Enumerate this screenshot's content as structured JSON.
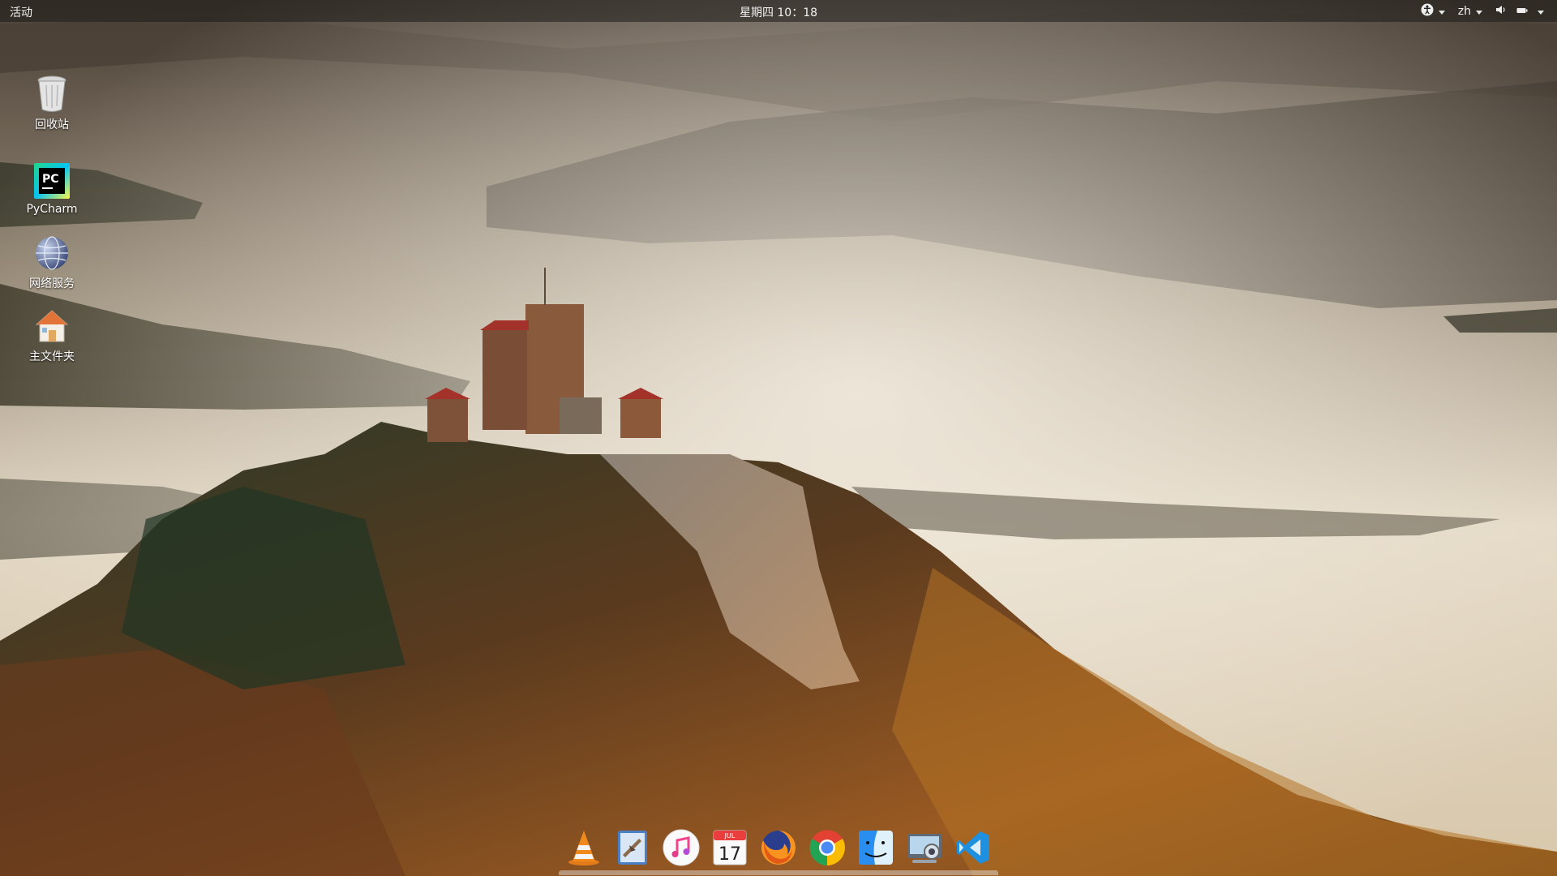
{
  "topbar": {
    "activities": "活动",
    "clock": "星期四 10：18",
    "language": "zh"
  },
  "desktop": {
    "icons": [
      {
        "label": "回收站",
        "icon": "trash-icon"
      },
      {
        "label": "PyCharm",
        "icon": "pycharm-icon",
        "badge": "PC"
      },
      {
        "label": "网络服务",
        "icon": "network-globe-icon"
      },
      {
        "label": "主文件夹",
        "icon": "home-folder-icon"
      }
    ]
  },
  "dock": {
    "items": [
      {
        "name": "vlc",
        "icon": "vlc-icon"
      },
      {
        "name": "mail",
        "icon": "mail-icon"
      },
      {
        "name": "music",
        "icon": "music-icon"
      },
      {
        "name": "calendar",
        "icon": "calendar-icon",
        "month": "JUL",
        "day": "17"
      },
      {
        "name": "firefox",
        "icon": "firefox-icon"
      },
      {
        "name": "chrome",
        "icon": "chrome-icon"
      },
      {
        "name": "finder",
        "icon": "finder-icon"
      },
      {
        "name": "screenshot",
        "icon": "screenshot-icon"
      },
      {
        "name": "vscode",
        "icon": "vscode-icon"
      }
    ]
  },
  "colors": {
    "topbar_bg": "#1c1a18",
    "fog": "#e8e0d0",
    "hill_dark": "#3b3024",
    "autumn": "#b06a2a",
    "vscode": "#1f8fe0"
  }
}
